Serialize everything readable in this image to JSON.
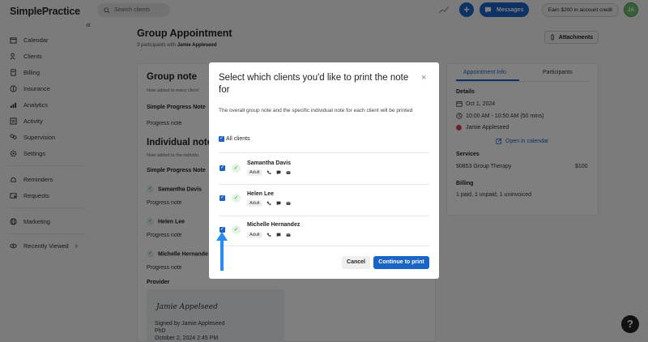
{
  "app": {
    "logo": "SimplePractice",
    "collapse_glyph": "«"
  },
  "sidebar": {
    "items": [
      {
        "label": "Calendar",
        "icon": "calendar-icon"
      },
      {
        "label": "Clients",
        "icon": "clients-icon"
      },
      {
        "label": "Billing",
        "icon": "billing-icon"
      },
      {
        "label": "Insurance",
        "icon": "insurance-icon"
      },
      {
        "label": "Analytics",
        "icon": "analytics-icon"
      },
      {
        "label": "Activity",
        "icon": "activity-icon"
      },
      {
        "label": "Supervision",
        "icon": "supervision-icon"
      },
      {
        "label": "Settings",
        "icon": "settings-icon"
      },
      {
        "label": "Reminders",
        "icon": "bell-icon"
      },
      {
        "label": "Requests",
        "icon": "requests-icon"
      },
      {
        "label": "Marketing",
        "icon": "globe-icon"
      },
      {
        "label": "Recently Viewed",
        "icon": "eye-icon"
      }
    ]
  },
  "topbar": {
    "search_placeholder": "Search clients",
    "plus_label": "+",
    "messages_label": "Messages",
    "credit_label": "Earn $200 in account credit",
    "avatar_initials": "JA"
  },
  "page": {
    "title": "Group Appointment",
    "subtitle_prefix": "3 participants with",
    "subtitle_name": "Jamie Appleseed",
    "attachments_label": "Attachments"
  },
  "note_card": {
    "group_heading": "Group note",
    "group_sub": "Note added to every client'",
    "group_note_type": "Simple Progress Note",
    "group_note_label": "Progress note",
    "individual_heading": "Individual note",
    "individual_sub": "Note added to the individu",
    "individual_note_type": "Simple Progress Note",
    "clients": [
      {
        "name": "Samantha Davis",
        "note": "Progress note"
      },
      {
        "name": "Helen Lee",
        "note": "Progress note"
      },
      {
        "name": "Michelle Hernande",
        "note": "Progress note"
      }
    ],
    "provider_label": "Provider",
    "signature_script": "Jamie Appelseed",
    "signed_by": "Signed by Jamie Appleseed",
    "credential": "PhD",
    "signed_date": "October 2, 2024 2:45 PM"
  },
  "side_card": {
    "tab_info": "Appointment Info",
    "tab_participants": "Participants",
    "details_label": "Details",
    "date": "Oct 1, 2024",
    "time": "10:00 AM - 10:50 AM (50 mins)",
    "clinician": "Jamie Appleseed",
    "calendar_link": "Open in calendar",
    "services_label": "Services",
    "service_name": "90853 Group Therapy",
    "service_price": "$100",
    "billing_label": "Billing",
    "billing_status": "1 paid, 1 unpaid, 1 uninvoiced"
  },
  "modal": {
    "title": "Select which clients you'd like to print the note for",
    "close_glyph": "×",
    "description": "The overall group note and the specific individual note for each client will be printed",
    "all_clients_label": "All clients",
    "clients": [
      {
        "name": "Samantha Davis",
        "badge": "Adult",
        "checked": true
      },
      {
        "name": "Helen Lee",
        "badge": "Adult",
        "checked": true
      },
      {
        "name": "Michelle Hernandez",
        "badge": "Adult",
        "checked": true
      }
    ],
    "cancel_label": "Cancel",
    "continue_label": "Continue to print"
  },
  "help_glyph": "?",
  "colors": {
    "accent": "#1a64c6",
    "success": "#3a9c41",
    "avatar": "#6fbf73",
    "danger": "#d64545"
  }
}
